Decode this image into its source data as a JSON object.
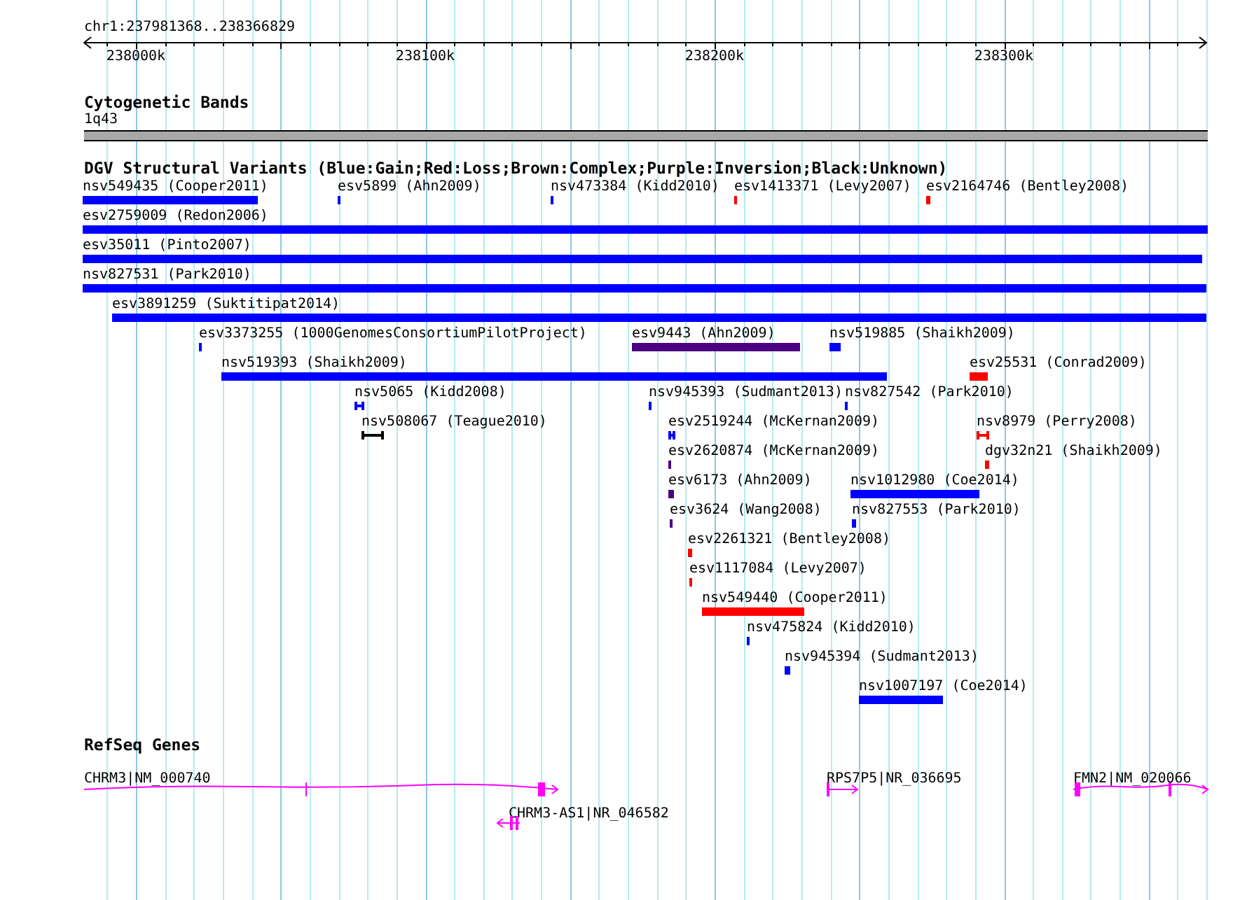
{
  "ruler": {
    "position": "chr1:237981368..238366829",
    "ticks": [
      "238000k",
      "238100k",
      "238200k",
      "238300k"
    ]
  },
  "cytogenetic_track": {
    "title": "Cytogenetic Bands",
    "band": "1q43"
  },
  "variant_track": {
    "title": "DGV Structural Variants (Blue:Gain;Red:Loss;Brown:Complex;Purple:Inversion;Black:Unknown)",
    "features": [
      {
        "label": "nsv549435 (Cooper2011)",
        "color": "#0000ff",
        "kind": "bar"
      },
      {
        "label": "esv5899 (Ahn2009)",
        "color": "#0000ff",
        "kind": "bar"
      },
      {
        "label": "nsv473384 (Kidd2010)",
        "color": "#0000ff",
        "kind": "bar"
      },
      {
        "label": "esv1413371 (Levy2007)",
        "color": "#ff0000",
        "kind": "bar"
      },
      {
        "label": "esv2164746 (Bentley2008)",
        "color": "#ff0000",
        "kind": "bar"
      },
      {
        "label": "esv2759009 (Redon2006)",
        "color": "#0000ff",
        "kind": "bar"
      },
      {
        "label": "esv35011 (Pinto2007)",
        "color": "#0000ff",
        "kind": "bar"
      },
      {
        "label": "nsv827531 (Park2010)",
        "color": "#0000ff",
        "kind": "bar"
      },
      {
        "label": "esv3891259 (Suktitipat2014)",
        "color": "#0000ff",
        "kind": "bar"
      },
      {
        "label": "esv3373255 (1000GenomesConsortiumPilotProject)",
        "color": "#0000ff",
        "kind": "bar"
      },
      {
        "label": "esv9443 (Ahn2009)",
        "color": "#4b0082",
        "kind": "bar"
      },
      {
        "label": "nsv519885 (Shaikh2009)",
        "color": "#0000ff",
        "kind": "bar"
      },
      {
        "label": "nsv519393 (Shaikh2009)",
        "color": "#0000ff",
        "kind": "bar"
      },
      {
        "label": "esv25531 (Conrad2009)",
        "color": "#ff0000",
        "kind": "bar"
      },
      {
        "label": "nsv5065 (Kidd2008)",
        "color": "#0000ff",
        "kind": "interval"
      },
      {
        "label": "nsv945393 (Sudmant2013)",
        "color": "#0000ff",
        "kind": "bar"
      },
      {
        "label": "nsv827542 (Park2010)",
        "color": "#0000ff",
        "kind": "bar"
      },
      {
        "label": "nsv508067 (Teague2010)",
        "color": "#000000",
        "kind": "interval"
      },
      {
        "label": "esv2519244 (McKernan2009)",
        "color": "#0000ff",
        "kind": "interval"
      },
      {
        "label": "nsv8979 (Perry2008)",
        "color": "#ff0000",
        "kind": "interval"
      },
      {
        "label": "esv2620874 (McKernan2009)",
        "color": "#4b0082",
        "kind": "bar"
      },
      {
        "label": "dgv32n21 (Shaikh2009)",
        "color": "#ff0000",
        "kind": "bar"
      },
      {
        "label": "esv6173 (Ahn2009)",
        "color": "#4b0082",
        "kind": "bar"
      },
      {
        "label": "nsv1012980 (Coe2014)",
        "color": "#0000ff",
        "kind": "bar"
      },
      {
        "label": "esv3624 (Wang2008)",
        "color": "#4b0082",
        "kind": "bar"
      },
      {
        "label": "nsv827553 (Park2010)",
        "color": "#0000ff",
        "kind": "bar"
      },
      {
        "label": "esv2261321 (Bentley2008)",
        "color": "#ff0000",
        "kind": "bar"
      },
      {
        "label": "esv1117084 (Levy2007)",
        "color": "#ff0000",
        "kind": "bar"
      },
      {
        "label": "nsv549440 (Cooper2011)",
        "color": "#ff0000",
        "kind": "bar"
      },
      {
        "label": "nsv475824 (Kidd2010)",
        "color": "#0000ff",
        "kind": "bar"
      },
      {
        "label": "nsv945394 (Sudmant2013)",
        "color": "#0000ff",
        "kind": "bar"
      },
      {
        "label": "nsv1007197 (Coe2014)",
        "color": "#0000ff",
        "kind": "bar"
      }
    ]
  },
  "gene_track": {
    "title": "RefSeq Genes",
    "genes": [
      {
        "label": "CHRM3|NM_000740",
        "kind": "forward"
      },
      {
        "label": "CHRM3-AS1|NR_046582",
        "kind": "reverse"
      },
      {
        "label": "RPS7P5|NR_036695",
        "kind": "forward"
      },
      {
        "label": "FMN2|NM_020066",
        "kind": "forward"
      }
    ]
  }
}
